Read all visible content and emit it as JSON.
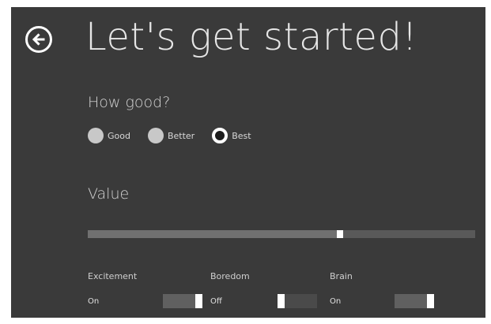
{
  "header": {
    "title": "Let's get started!",
    "back_icon": "back-arrow-circle-icon"
  },
  "quality": {
    "label": "How good?",
    "options": [
      {
        "label": "Good",
        "selected": false
      },
      {
        "label": "Better",
        "selected": false
      },
      {
        "label": "Best",
        "selected": true
      }
    ]
  },
  "value_slider": {
    "label": "Value",
    "value": 0.65
  },
  "toggles": [
    {
      "label": "Excitement",
      "state_label": "On",
      "on": true
    },
    {
      "label": "Boredom",
      "state_label": "Off",
      "on": false
    },
    {
      "label": "Brain",
      "state_label": "On",
      "on": true
    }
  ],
  "colors": {
    "panel_background": "#3a3a3a",
    "text": "#e6e6e6",
    "accent": "#ffffff"
  }
}
